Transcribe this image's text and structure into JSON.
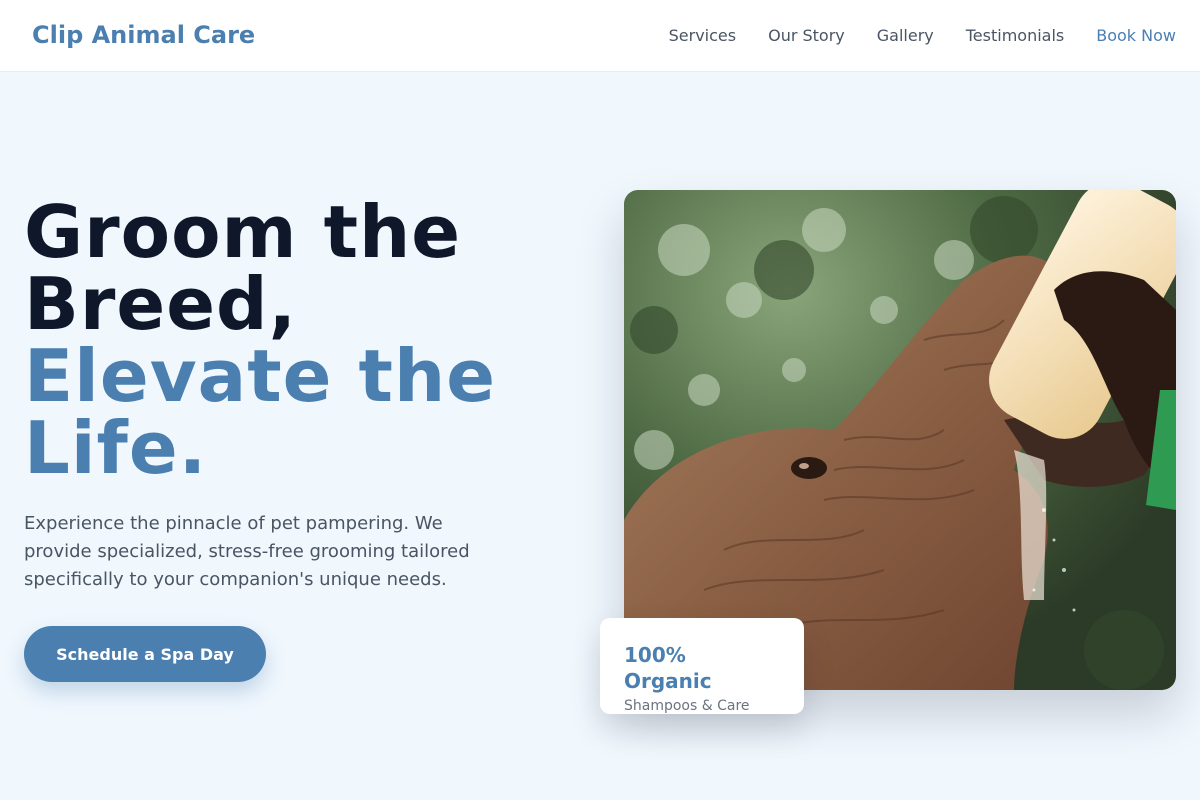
{
  "header": {
    "brand": "Clip Animal Care",
    "nav": {
      "services": "Services",
      "our_story": "Our Story",
      "gallery": "Gallery",
      "testimonials": "Testimonials",
      "book_now": "Book Now"
    }
  },
  "hero": {
    "title_line1": "Groom the",
    "title_line2": "Breed,",
    "title_accent1": "Elevate the",
    "title_accent2": "Life.",
    "subtitle": "Experience the pinnacle of pet pampering. We provide specialized, stress-free grooming tailored specifically to your companion's unique needs.",
    "cta": "Schedule a Spa Day"
  },
  "image": {
    "alt": "elephant-feeding-photo"
  },
  "badge": {
    "title": "100% Organic",
    "subtitle": "Shampoos & Care"
  },
  "colors": {
    "accent": "#4a7fb0",
    "heading": "#0f172a",
    "background": "#f0f7fd"
  }
}
